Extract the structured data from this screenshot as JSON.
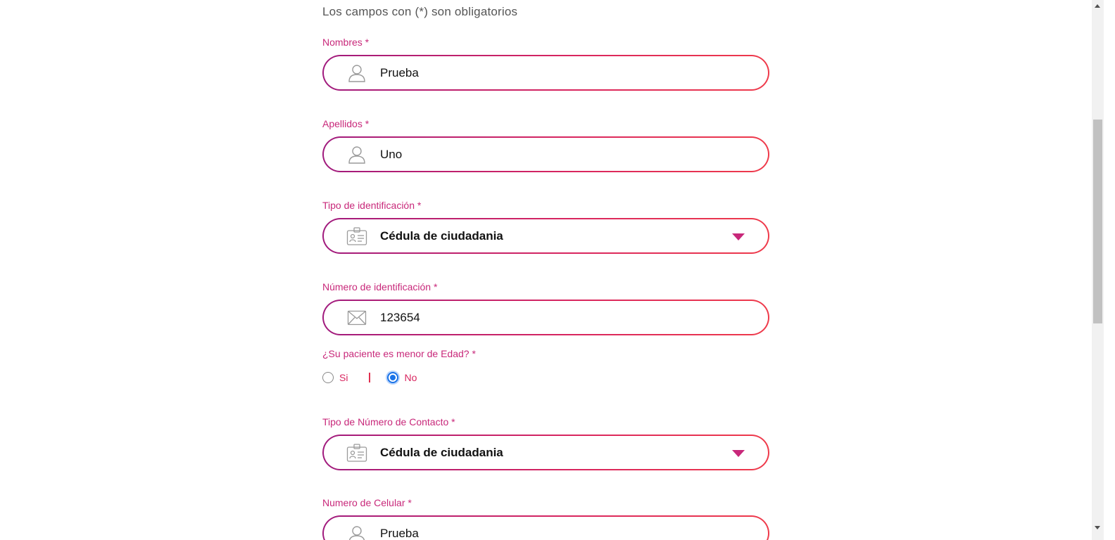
{
  "form": {
    "required_note": "Los campos con (*) son obligatorios",
    "fields": [
      {
        "label": "Nombres *",
        "value": "Prueba",
        "icon": "user-icon"
      },
      {
        "label": "Apellidos *",
        "value": "Uno",
        "icon": "user-icon"
      },
      {
        "label": "Tipo de identificación *",
        "value": "Cédula de ciudadania",
        "icon": "id-card-icon",
        "type": "select"
      },
      {
        "label": "Número de identificación *",
        "value": "123654",
        "icon": "envelope-icon"
      },
      {
        "label": "Tipo de Número de Contacto *",
        "value": "Cédula de ciudadania",
        "icon": "id-card-icon",
        "type": "select"
      },
      {
        "label": "Numero de Celular *",
        "value": "Prueba",
        "icon": "user-icon"
      }
    ],
    "minor_question": {
      "label": "¿Su paciente es menor de Edad? *",
      "options": [
        "Si",
        "No"
      ],
      "selected": "No"
    }
  },
  "colors": {
    "accent": "#c8287a",
    "gradient_start": "#a01a7d",
    "gradient_end": "#ef3a4a",
    "radio_selected": "#1a73e8"
  }
}
